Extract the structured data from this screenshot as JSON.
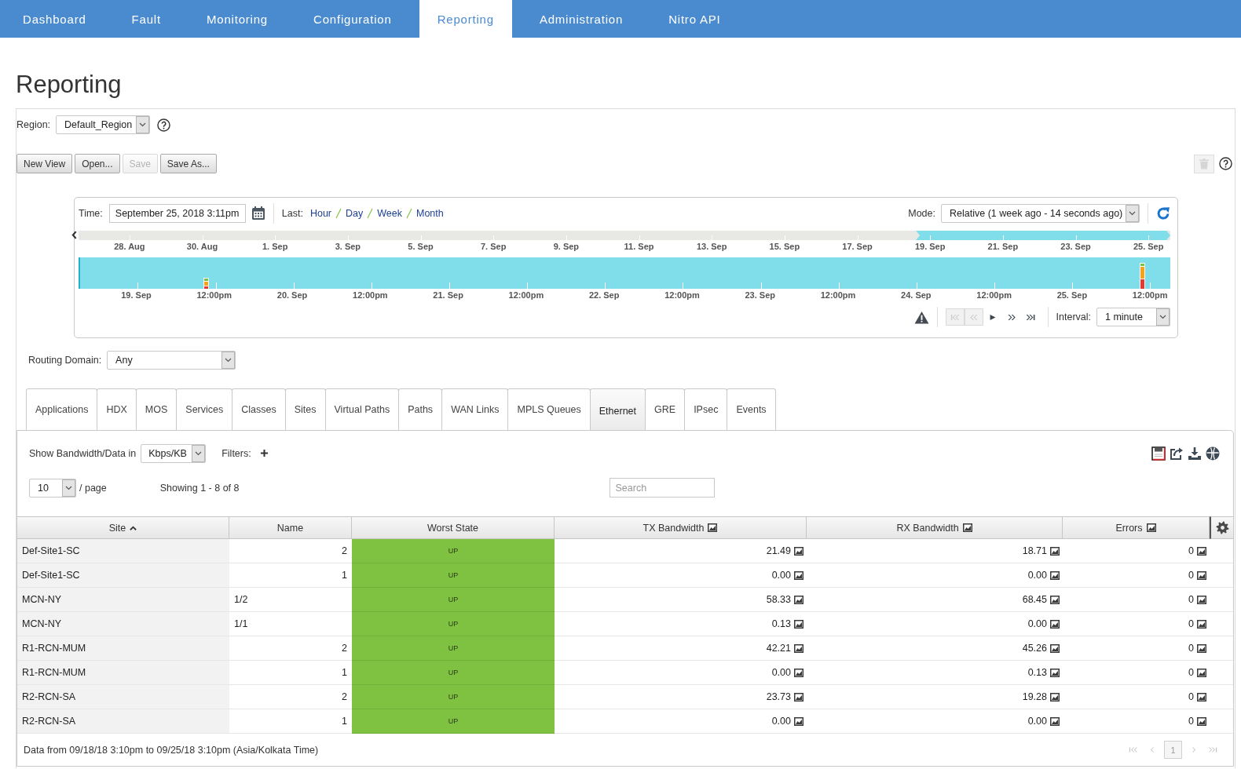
{
  "nav": [
    {
      "label": "Dashboard",
      "selected": false
    },
    {
      "label": "Fault",
      "selected": false
    },
    {
      "label": "Monitoring",
      "selected": false
    },
    {
      "label": "Configuration",
      "selected": false
    },
    {
      "label": "Reporting",
      "selected": true
    },
    {
      "label": "Administration",
      "selected": false
    },
    {
      "label": "Nitro API",
      "selected": false
    }
  ],
  "page_title": "Reporting",
  "region": {
    "label": "Region:",
    "value": "Default_Region"
  },
  "view_buttons": [
    {
      "label": "New View",
      "disabled": false
    },
    {
      "label": "Open...",
      "disabled": false
    },
    {
      "label": "Save",
      "disabled": true
    },
    {
      "label": "Save As...",
      "disabled": false
    }
  ],
  "delete_button": {
    "disabled": true
  },
  "timeline": {
    "time_label": "Time:",
    "time_value": "September 25, 2018 3:11pm",
    "last_label": "Last:",
    "last_links": [
      "Hour",
      "Day",
      "Week",
      "Month"
    ],
    "mode_label": "Mode:",
    "mode_value": "Relative (1 week ago - 14 seconds ago)",
    "overview_axis": [
      "28. Aug",
      "30. Aug",
      "1. Sep",
      "3. Sep",
      "5. Sep",
      "7. Sep",
      "9. Sep",
      "11. Sep",
      "13. Sep",
      "15. Sep",
      "17. Sep",
      "19. Sep",
      "21. Sep",
      "23. Sep",
      "25. Sep"
    ],
    "overview_selection": {
      "level": 0.233
    },
    "detail_axis": [
      "19. Sep",
      "12:00pm",
      "20. Sep",
      "12:00pm",
      "21. Sep",
      "12:00pm",
      "22. Sep",
      "12:00pm",
      "23. Sep",
      "12:00pm",
      "24. Sep",
      "12:00pm",
      "25. Sep",
      "12:00pm"
    ],
    "playback_controls": [
      {
        "kind": "first",
        "disabled": true
      },
      {
        "kind": "rewind",
        "disabled": true
      },
      {
        "kind": "play",
        "disabled": false
      },
      {
        "kind": "fast_forward",
        "disabled": false
      },
      {
        "kind": "last",
        "disabled": false
      }
    ],
    "interval_label": "Interval:",
    "interval_value": "1 minute"
  },
  "routing_domain": {
    "label": "Routing Domain:",
    "value": "Any"
  },
  "tabs": [
    {
      "label": "Applications",
      "selected": false
    },
    {
      "label": "HDX",
      "selected": false
    },
    {
      "label": "MOS",
      "selected": false
    },
    {
      "label": "Services",
      "selected": false
    },
    {
      "label": "Classes",
      "selected": false
    },
    {
      "label": "Sites",
      "selected": false
    },
    {
      "label": "Virtual Paths",
      "selected": false
    },
    {
      "label": "Paths",
      "selected": false
    },
    {
      "label": "WAN Links",
      "selected": false
    },
    {
      "label": "MPLS Queues",
      "selected": false
    },
    {
      "label": "Ethernet",
      "selected": true
    },
    {
      "label": "GRE",
      "selected": false
    },
    {
      "label": "IPsec",
      "selected": false
    },
    {
      "label": "Events",
      "selected": false
    }
  ],
  "panel": {
    "bandwidth_label": "Show Bandwidth/Data in",
    "bandwidth_unit": "Kbps/KB",
    "filters_label": "Filters:",
    "page_size": "10",
    "page_size_suffix": "/ page",
    "showing": "Showing 1 - 8 of 8",
    "search": {
      "placeholder": "Search"
    }
  },
  "table": {
    "columns": [
      {
        "label": "Site",
        "chart_icon": false,
        "sorted_ascending": true
      },
      {
        "label": "Name",
        "chart_icon": false,
        "sorted_ascending": false
      },
      {
        "label": "Worst State",
        "chart_icon": false,
        "sorted_ascending": false
      },
      {
        "label": "TX Bandwidth",
        "chart_icon": true,
        "sorted_ascending": false
      },
      {
        "label": "RX Bandwidth",
        "chart_icon": true,
        "sorted_ascending": false
      },
      {
        "label": "Errors",
        "chart_icon": true,
        "sorted_ascending": false
      }
    ],
    "rows": [
      {
        "kind": "number",
        "site": "Def-Site1-SC",
        "name": "2",
        "worst_state": {
          "text": "UP",
          "color": "#7fc241"
        },
        "tx": "21.49",
        "rx": "18.71",
        "errors": "0"
      },
      {
        "kind": "number",
        "site": "Def-Site1-SC",
        "name": "1",
        "worst_state": {
          "text": "UP",
          "color": "#7fc241"
        },
        "tx": "0.00",
        "rx": "0.00",
        "errors": "0"
      },
      {
        "kind": "text",
        "site": "MCN-NY",
        "name": "1/2",
        "worst_state": {
          "text": "UP",
          "color": "#7fc241"
        },
        "tx": "58.33",
        "rx": "68.45",
        "errors": "0"
      },
      {
        "kind": "text",
        "site": "MCN-NY",
        "name": "1/1",
        "worst_state": {
          "text": "UP",
          "color": "#7fc241"
        },
        "tx": "0.13",
        "rx": "0.00",
        "errors": "0"
      },
      {
        "kind": "number",
        "site": "R1-RCN-MUM",
        "name": "2",
        "worst_state": {
          "text": "UP",
          "color": "#7fc241"
        },
        "tx": "42.21",
        "rx": "45.26",
        "errors": "0"
      },
      {
        "kind": "number",
        "site": "R1-RCN-MUM",
        "name": "1",
        "worst_state": {
          "text": "UP",
          "color": "#7fc241"
        },
        "tx": "0.00",
        "rx": "0.13",
        "errors": "0"
      },
      {
        "kind": "number",
        "site": "R2-RCN-SA",
        "name": "2",
        "worst_state": {
          "text": "UP",
          "color": "#7fc241"
        },
        "tx": "23.73",
        "rx": "19.28",
        "errors": "0"
      },
      {
        "kind": "number",
        "site": "R2-RCN-SA",
        "name": "1",
        "worst_state": {
          "text": "UP",
          "color": "#7fc241"
        },
        "tx": "0.00",
        "rx": "0.00",
        "errors": "0"
      }
    ]
  },
  "footer": {
    "note": "Data from 09/18/18 3:10pm to 09/25/18 3:10pm (Asia/Kolkata Time)",
    "pager": [
      {
        "kind": "first",
        "disabled": true
      },
      {
        "kind": "previous",
        "disabled": true
      },
      {
        "kind": "page",
        "label": "1",
        "selected": true
      },
      {
        "kind": "next",
        "disabled": true
      },
      {
        "kind": "last",
        "disabled": true
      }
    ]
  }
}
